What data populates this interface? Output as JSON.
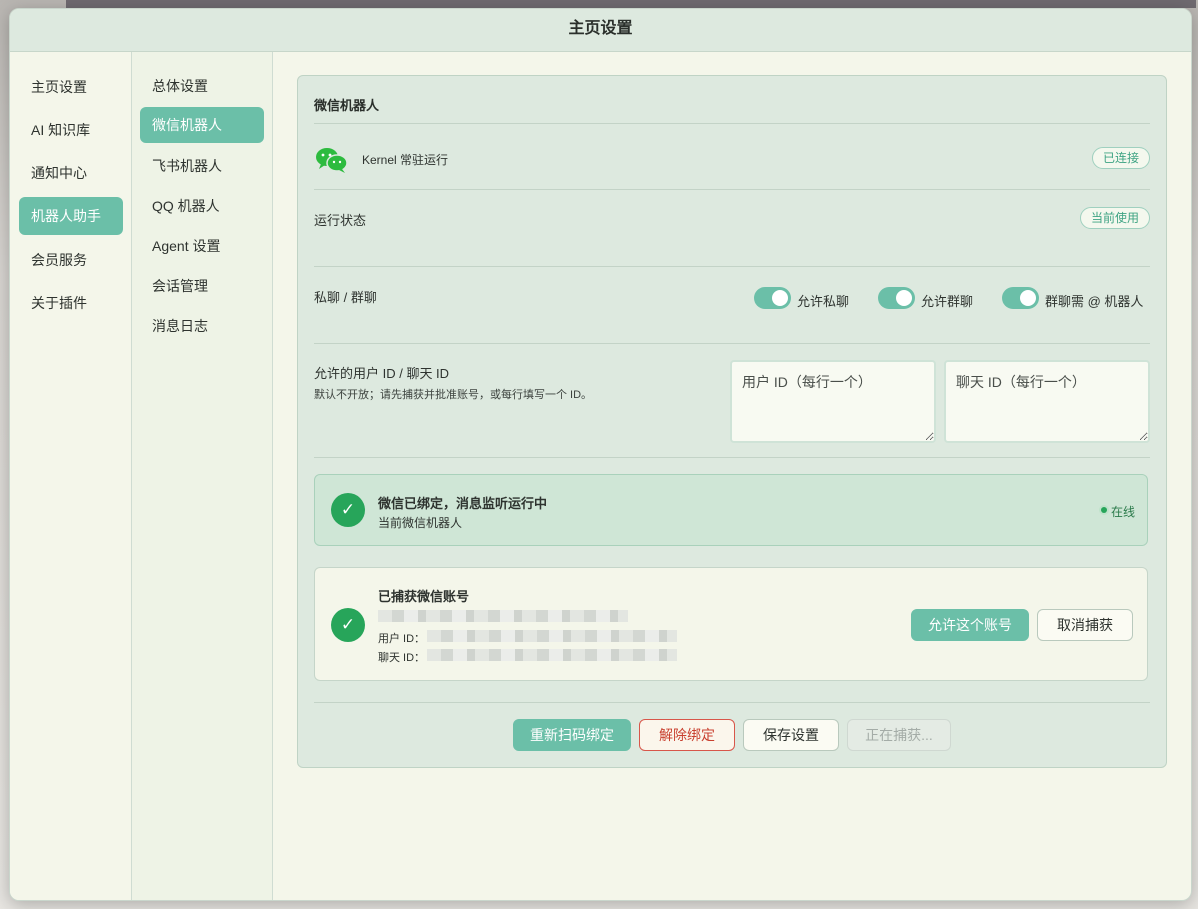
{
  "window": {
    "title": "主页设置"
  },
  "nav_primary": [
    {
      "label": "主页设置",
      "active": false
    },
    {
      "label": "AI 知识库",
      "active": false
    },
    {
      "label": "通知中心",
      "active": false
    },
    {
      "label": "机器人助手",
      "active": true
    },
    {
      "label": "会员服务",
      "active": false
    },
    {
      "label": "关于插件",
      "active": false
    }
  ],
  "nav_secondary": [
    {
      "label": "总体设置",
      "active": false
    },
    {
      "label": "微信机器人",
      "active": true
    },
    {
      "label": "飞书机器人",
      "active": false
    },
    {
      "label": "QQ 机器人",
      "active": false
    },
    {
      "label": "Agent 设置",
      "active": false
    },
    {
      "label": "会话管理",
      "active": false
    },
    {
      "label": "消息日志",
      "active": false
    }
  ],
  "panel": {
    "title": "微信机器人",
    "kernel": {
      "text": "Kernel 常驻运行",
      "badge": "已连接"
    },
    "run_status": {
      "label": "运行状态",
      "badge": "当前使用"
    },
    "chat_mode": {
      "label": "私聊 / 群聊",
      "toggles": [
        {
          "label": "允许私聊",
          "on": true
        },
        {
          "label": "允许群聊",
          "on": true
        },
        {
          "label": "群聊需 @ 机器人",
          "on": true
        }
      ]
    },
    "allow_ids": {
      "label": "允许的用户 ID / 聊天 ID",
      "hint": "默认不开放；请先捕获并批准账号，或每行填写一个 ID。",
      "user_placeholder": "用户 ID（每行一个）",
      "chat_placeholder": "聊天 ID（每行一个）"
    },
    "bind_status": {
      "title": "微信已绑定，消息监听运行中",
      "subtitle": "当前微信机器人",
      "online_label": "在线"
    },
    "captured": {
      "title": "已捕获微信账号",
      "user_id_label": "用户 ID：",
      "chat_id_label": "聊天 ID：",
      "allow_button": "允许这个账号",
      "cancel_button": "取消捕获"
    },
    "actions": {
      "rescan": "重新扫码绑定",
      "unbind": "解除绑定",
      "save": "保存设置",
      "capturing": "正在捕获..."
    }
  },
  "colors": {
    "accent": "#6bbfa8",
    "success": "#27a55a",
    "danger": "#c9402f",
    "panel_bg": "#dde9df"
  },
  "icons": [
    "wechat-icon",
    "check-icon",
    "online-dot-icon"
  ]
}
